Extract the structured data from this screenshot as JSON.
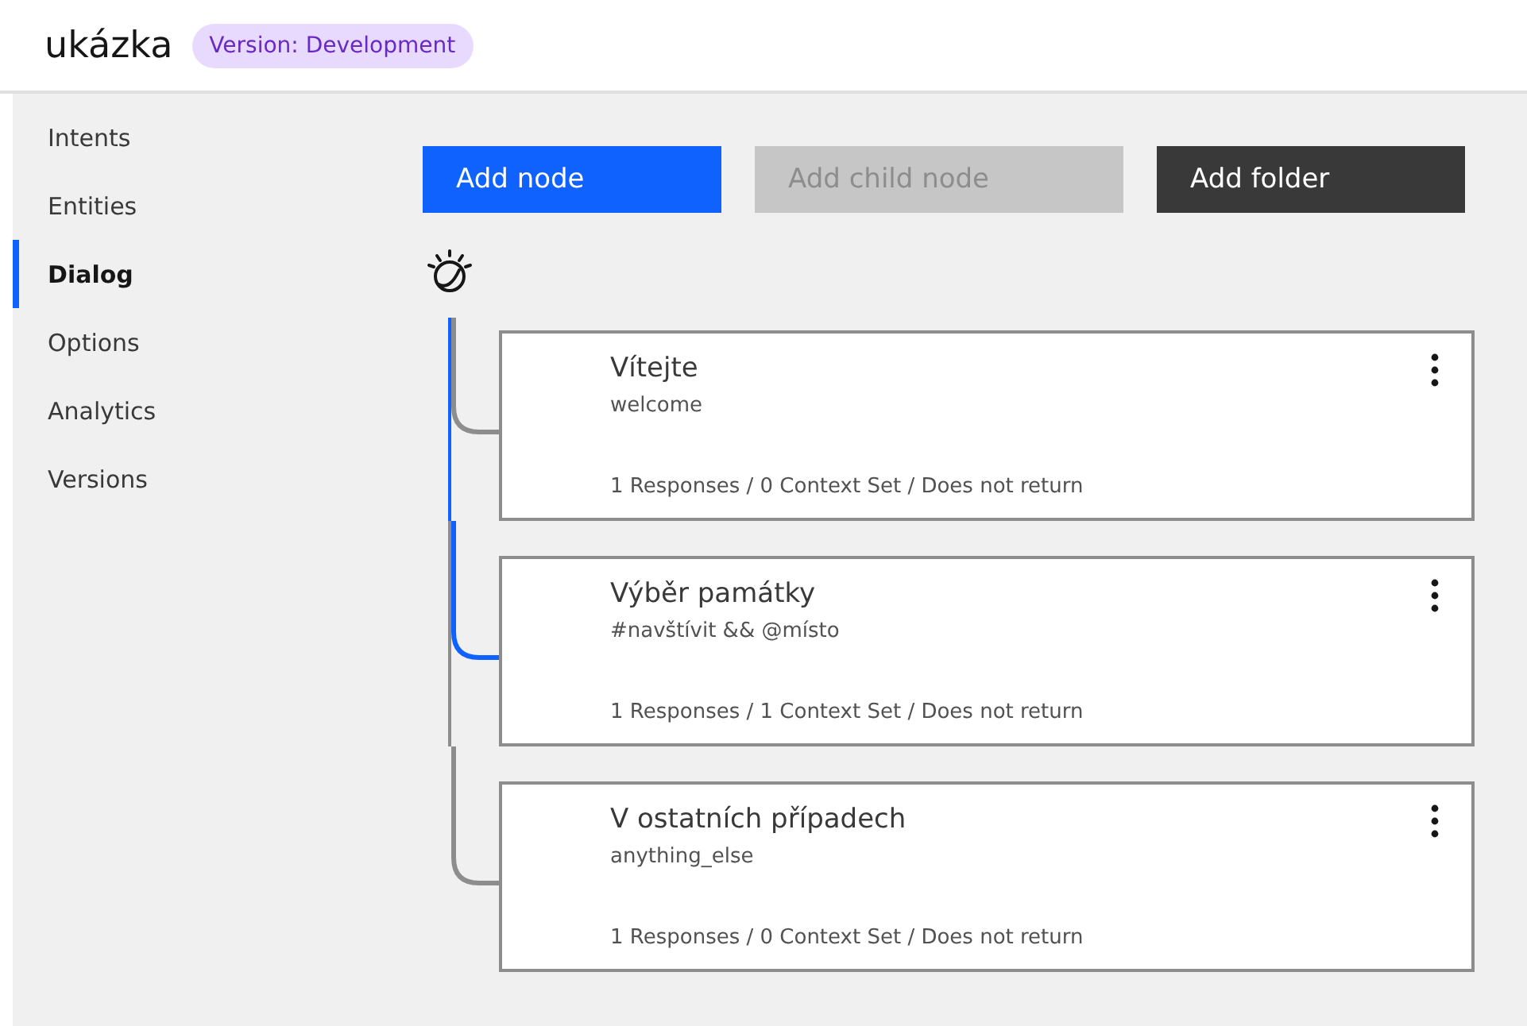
{
  "header": {
    "title": "ukázka",
    "badge": "Version: Development"
  },
  "sidebar": {
    "items": [
      {
        "label": "Intents",
        "selected": false
      },
      {
        "label": "Entities",
        "selected": false
      },
      {
        "label": "Dialog",
        "selected": true
      },
      {
        "label": "Options",
        "selected": false
      },
      {
        "label": "Analytics",
        "selected": false
      },
      {
        "label": "Versions",
        "selected": false
      }
    ]
  },
  "toolbar": [
    {
      "label": "Add node",
      "kind": "primary",
      "disabled": false
    },
    {
      "label": "Add child node",
      "kind": "secondary",
      "disabled": true
    },
    {
      "label": "Add folder",
      "kind": "dark",
      "disabled": false
    }
  ],
  "nodes": [
    {
      "title": "Vítejte",
      "condition": "welcome",
      "summary": "1 Responses / 0 Context Set / Does not return",
      "selected": false
    },
    {
      "title": "Výběr památky",
      "condition": "#navštívit && @místo",
      "summary": "1 Responses / 1 Context Set / Does not return",
      "selected": true
    },
    {
      "title": "V ostatních případech",
      "condition": "anything_else",
      "summary": "1 Responses / 0 Context Set / Does not return",
      "selected": false
    }
  ]
}
